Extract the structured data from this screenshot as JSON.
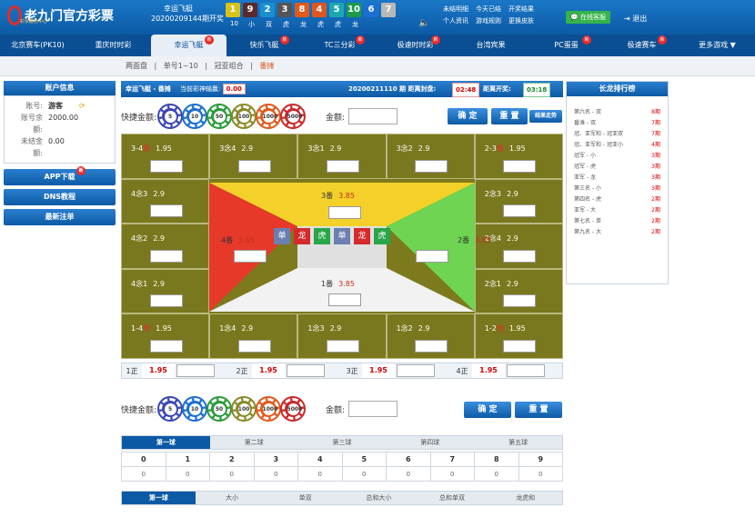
{
  "brand": {
    "title": "老九门官方彩票",
    "subtitle": "彩票服务中心"
  },
  "header": {
    "game_name": "幸运飞艇",
    "period_label": "20200209144期开奖",
    "balls": [
      {
        "n": "1",
        "color": "#d8c21a"
      },
      {
        "n": "9",
        "color": "#5a2a2a"
      },
      {
        "n": "2",
        "color": "#1a8fd0"
      },
      {
        "n": "3",
        "color": "#555555"
      },
      {
        "n": "8",
        "color": "#e05a1a"
      },
      {
        "n": "4",
        "color": "#e0561e"
      },
      {
        "n": "5",
        "color": "#1aa7b0"
      },
      {
        "n": "10",
        "color": "#1a9b4a"
      },
      {
        "n": "6",
        "color": "#1a6fd0"
      },
      {
        "n": "7",
        "color": "#b8b8b8"
      }
    ],
    "ball_subs": [
      "10",
      "小",
      "双",
      "虎",
      "龙",
      "虎",
      "虎",
      "龙"
    ],
    "links_row1": [
      "未结明细",
      "今天已结",
      "开奖结果"
    ],
    "links_row2": [
      "个人资讯",
      "游戏规则",
      "更换皮肤"
    ],
    "online_service": "在线客服",
    "logout": "退出"
  },
  "nav": [
    {
      "label": "北京赛车(PK10)",
      "badge": false
    },
    {
      "label": "重庆时时彩",
      "badge": false
    },
    {
      "label": "幸运飞艇",
      "badge": true,
      "active": true
    },
    {
      "label": "快乐飞艇",
      "badge": true
    },
    {
      "label": "TC三分彩",
      "badge": true
    },
    {
      "label": "极速时时彩",
      "badge": true
    },
    {
      "label": "台湾宾果",
      "badge": false
    },
    {
      "label": "PC蛋蛋",
      "badge": true
    },
    {
      "label": "极速赛车",
      "badge": true
    },
    {
      "label": "更多游戏 ▼",
      "badge": false
    }
  ],
  "badge_text": "新",
  "subnav": {
    "items": [
      "两面盘",
      "单号1~10",
      "冠亚组合"
    ],
    "active": "番摊",
    "sep": "|"
  },
  "account": {
    "head": "账户信息",
    "account_label": "账号:",
    "account_value": "游客",
    "balance_label": "账号余额:",
    "balance_value": "2000.00",
    "unsettled_label": "未结金额:",
    "unsettled_value": "0.00"
  },
  "side_buttons": [
    "APP下载",
    "DNS教程",
    "最新注单"
  ],
  "infobar": {
    "game": "幸运飞艇 - 番摊",
    "win_label": "当前彩神输赢:",
    "win_value": "0.00",
    "period": "20200211110 期 距离封盘:",
    "close_time": "02:48",
    "open_label": "距离开奖:",
    "open_time": "03:18"
  },
  "chips": [
    {
      "v": "5",
      "c": "#3b46b5"
    },
    {
      "v": "10",
      "c": "#1a6fd0"
    },
    {
      "v": "50",
      "c": "#2a9b3a"
    },
    {
      "v": "100",
      "c": "#8a8a2a"
    },
    {
      "v": "1000",
      "c": "#e05a1a"
    },
    {
      "v": "5000",
      "c": "#c82a2a"
    }
  ],
  "quick_label": "快捷金额:",
  "amount_label": "金额:",
  "confirm": "确 定",
  "reset": "重 置",
  "result_trend": "结果走势",
  "board": {
    "top": [
      [
        "3-4",
        "角",
        "1.95"
      ],
      [
        "3念4",
        "",
        "2.9"
      ],
      [
        "3念1",
        "",
        "2.9"
      ],
      [
        "3念2",
        "",
        "2.9"
      ],
      [
        "2-3",
        "角",
        "1.95"
      ]
    ],
    "left": [
      [
        "4念3",
        "2.9"
      ],
      [
        "4念2",
        "2.9"
      ],
      [
        "4念1",
        "2.9"
      ]
    ],
    "right": [
      [
        "2念3",
        "2.9"
      ],
      [
        "2念4",
        "2.9"
      ],
      [
        "2念1",
        "2.9"
      ]
    ],
    "bottom": [
      [
        "1-4",
        "角",
        "1.95"
      ],
      [
        "1念4",
        "",
        "2.9"
      ],
      [
        "1念3",
        "",
        "2.9"
      ],
      [
        "1念2",
        "",
        "2.9"
      ],
      [
        "1-2",
        "角",
        "1.95"
      ]
    ],
    "top_fan": [
      "3番",
      "3.85"
    ],
    "left_fan": [
      "4番",
      "3.85"
    ],
    "right_fan": [
      "2番",
      "3.85"
    ],
    "bottom_fan": [
      "1番",
      "3.85"
    ],
    "tiles": [
      [
        "单",
        "#6b7fb0"
      ],
      [
        "龙",
        "#d42a2a"
      ],
      [
        "虎",
        "#2aa64a"
      ],
      [
        "单",
        "#6b7fb0"
      ],
      [
        "龙",
        "#d42a2a"
      ],
      [
        "虎",
        "#2aa64a"
      ]
    ]
  },
  "zheng": [
    [
      "1正",
      "1.95"
    ],
    [
      "2正",
      "1.95"
    ],
    [
      "3正",
      "1.95"
    ],
    [
      "4正",
      "1.95"
    ]
  ],
  "ball_tabs": [
    "第一球",
    "第二球",
    "第三球",
    "第四球",
    "第五球"
  ],
  "numbers": [
    "0",
    "1",
    "2",
    "3",
    "4",
    "5",
    "6",
    "7",
    "8",
    "9"
  ],
  "number_values": [
    "0",
    "0",
    "0",
    "0",
    "0",
    "0",
    "0",
    "0",
    "0",
    "0"
  ],
  "stat_tabs": [
    "第一球",
    "大小",
    "单双",
    "总和大小",
    "总和单双",
    "龙虎和"
  ],
  "ranking": {
    "head": "长龙排行榜",
    "rows": [
      [
        "第六名 - 双",
        "8期"
      ],
      [
        "番滩 - 双",
        "7期"
      ],
      [
        "冠、亚军和 - 冠亚双",
        "7期"
      ],
      [
        "冠、亚军和 - 冠亚小",
        "4期"
      ],
      [
        "冠军 - 小",
        "3期"
      ],
      [
        "冠军 - 虎",
        "3期"
      ],
      [
        "亚军 - 龙",
        "3期"
      ],
      [
        "第三名 - 小",
        "3期"
      ],
      [
        "第四名 - 虎",
        "2期"
      ],
      [
        "亚军 - 大",
        "2期"
      ],
      [
        "第七名 - 单",
        "2期"
      ],
      [
        "第九名 - 大",
        "2期"
      ]
    ]
  }
}
